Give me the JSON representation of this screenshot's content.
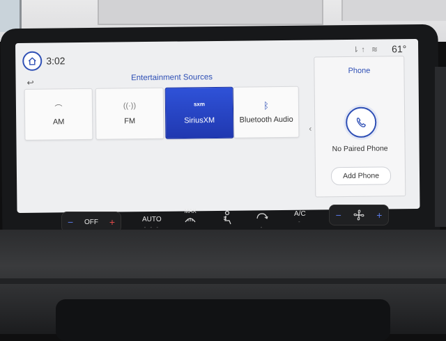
{
  "status_bar": {
    "time": "3:02",
    "temperature": "61°",
    "home_icon": "home-icon",
    "signal_icons": "⇂↑ ≋"
  },
  "sources": {
    "title": "Entertainment Sources",
    "back_icon": "back-arrow-icon",
    "items": [
      {
        "label": "AM",
        "icon": "radio-antenna-icon",
        "glyph": "⌒",
        "active": false
      },
      {
        "label": "FM",
        "icon": "radio-wave-icon",
        "glyph": "((·))",
        "active": false
      },
      {
        "label": "SiriusXM",
        "icon": "sxm-logo-icon",
        "glyph": "sxm",
        "active": true
      },
      {
        "label": "Bluetooth Audio",
        "icon": "bluetooth-icon",
        "glyph": "ᛒ",
        "active": false
      }
    ],
    "scroll_icon": "chevron-left-icon"
  },
  "phone": {
    "title": "Phone",
    "status": "No Paired Phone",
    "add_button": "Add Phone",
    "icon": "phone-handset-icon"
  },
  "climate": {
    "driver_temp": "OFF",
    "auto": "AUTO",
    "max_defrost": "MAX",
    "ac": "A/C",
    "minus": "−",
    "plus": "+",
    "auto_dashes": "- - -",
    "ac_dash": "-"
  },
  "colors": {
    "accent": "#2e4fb5",
    "active_tile": "#2038b0",
    "screen_bg": "#eeeff1"
  }
}
